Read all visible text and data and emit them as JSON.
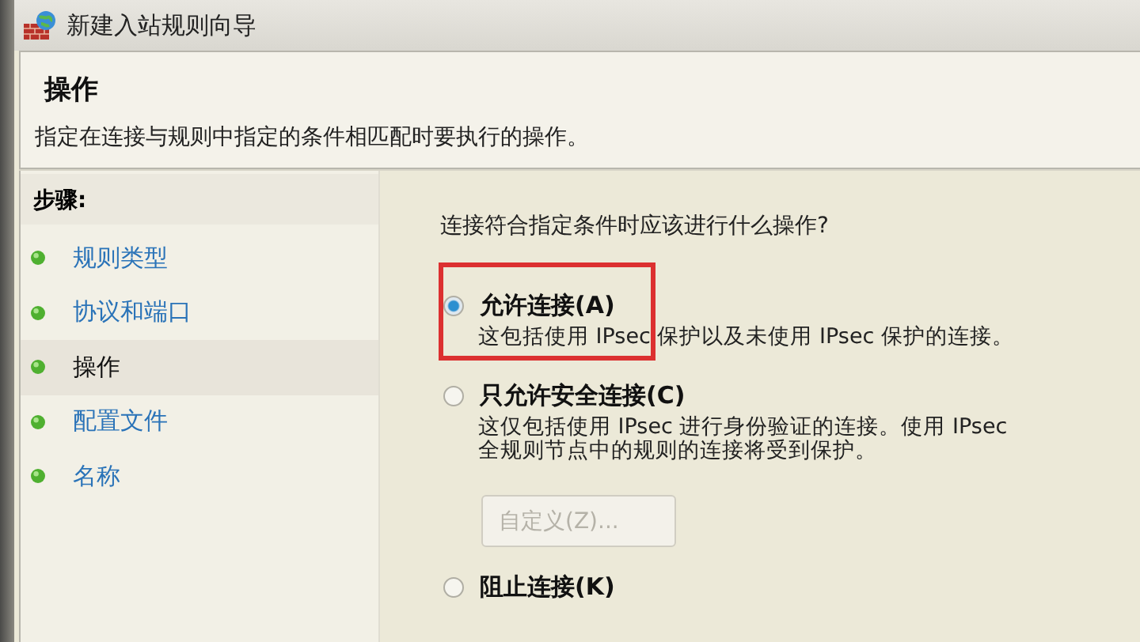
{
  "window": {
    "title": "新建入站规则向导"
  },
  "header": {
    "title": "操作",
    "description": "指定在连接与规则中指定的条件相匹配时要执行的操作。"
  },
  "steps": {
    "heading": "步骤:",
    "items": [
      {
        "label": "规则类型",
        "selected": false
      },
      {
        "label": "协议和端口",
        "selected": false
      },
      {
        "label": "操作",
        "selected": true
      },
      {
        "label": "配置文件",
        "selected": false
      },
      {
        "label": "名称",
        "selected": false
      }
    ]
  },
  "question": "连接符合指定条件时应该进行什么操作?",
  "options": [
    {
      "label": "允许连接(A)",
      "selected": true,
      "highlighted": true,
      "description": [
        "这包括使用 IPsec 保护以及未使用 IPsec 保护的连接。"
      ]
    },
    {
      "label": "只允许安全连接(C)",
      "selected": false,
      "highlighted": false,
      "description": [
        "这仅包括使用 IPsec 进行身份验证的连接。使用 IPsec",
        "全规则节点中的规则的连接将受到保护。"
      ],
      "button": {
        "label": "自定义(Z)...",
        "disabled": true
      }
    },
    {
      "label": "阻止连接(K)",
      "selected": false,
      "highlighted": false
    }
  ]
}
